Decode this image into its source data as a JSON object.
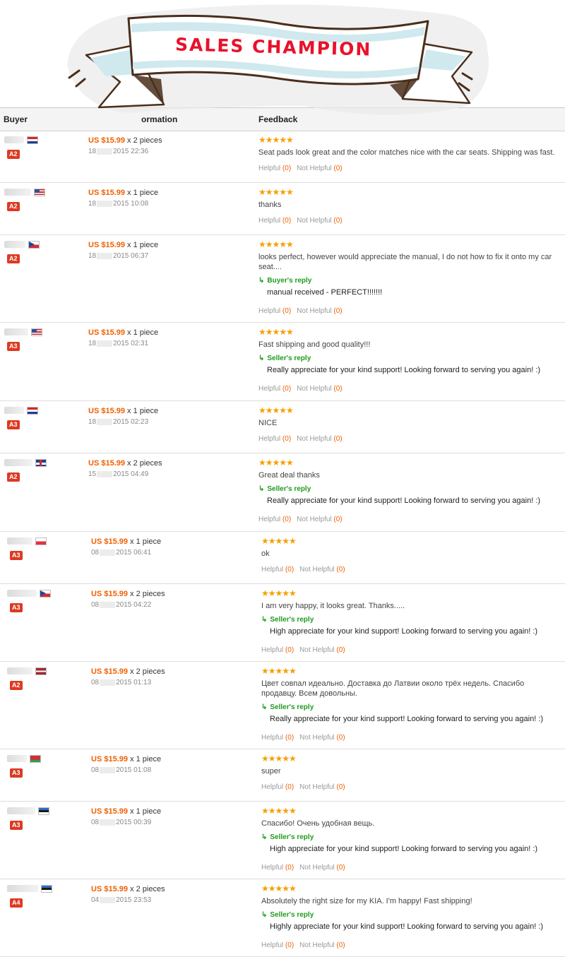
{
  "banner": {
    "title": "SALES CHAMPION"
  },
  "header": {
    "buyer": "Buyer",
    "order": "ormation",
    "feedback": "Feedback"
  },
  "helpful": {
    "helpful_label": "Helpful",
    "not_helpful_label": "Not Helpful"
  },
  "colors": {
    "price": "#f06000",
    "stars": "#f5a000",
    "badge": "#dd3a22",
    "reply": "#1f9a1f",
    "banner_text": "#e8122a"
  },
  "rows": [
    {
      "flag": "croatia-flag",
      "level": "A2",
      "price": "US $15.99",
      "qty": "x 2 pieces",
      "date_a": "18",
      "date_b": "2015 22:36",
      "stars": "★★★★★",
      "text": "Seat pads look great and the color matches nice with the car seats. Shipping was fast.",
      "reply_label": "",
      "reply_text": "",
      "helpful_count": "(0)",
      "not_helpful_count": "(0)"
    },
    {
      "flag": "usa-flag",
      "level": "A2",
      "price": "US $15.99",
      "qty": "x 1 piece",
      "date_a": "18",
      "date_b": "2015 10:08",
      "stars": "★★★★★",
      "text": "thanks",
      "reply_label": "",
      "reply_text": "",
      "helpful_count": "(0)",
      "not_helpful_count": "(0)"
    },
    {
      "flag": "czech-flag",
      "level": "A2",
      "price": "US $15.99",
      "qty": "x 1 piece",
      "date_a": "18",
      "date_b": "2015 06:37",
      "stars": "★★★★★",
      "text": "looks perfect, however would appreciate the manual, I do not how to fix it onto my car seat....",
      "reply_label": "Buyer's reply",
      "reply_text": "manual received - PERFECT!!!!!!!",
      "helpful_count": "(0)",
      "not_helpful_count": "(0)"
    },
    {
      "flag": "usa-flag",
      "level": "A3",
      "price": "US $15.99",
      "qty": "x 1 piece",
      "date_a": "18",
      "date_b": "2015 02:31",
      "stars": "★★★★★",
      "text": "Fast shipping and good quality!!!",
      "reply_label": "Seller's reply",
      "reply_text": "Really appreciate for your kind support! Looking forward to serving you again! :)",
      "helpful_count": "(0)",
      "not_helpful_count": "(0)"
    },
    {
      "flag": "croatia-flag",
      "level": "A3",
      "price": "US $15.99",
      "qty": "x 1 piece",
      "date_a": "18",
      "date_b": "2015 02:23",
      "stars": "★★★★★",
      "text": "NICE",
      "reply_label": "",
      "reply_text": "",
      "helpful_count": "(0)",
      "not_helpful_count": "(0)"
    },
    {
      "flag": "uk-flag",
      "level": "A2",
      "price": "US $15.99",
      "qty": "x 2 pieces",
      "date_a": "15",
      "date_b": "2015 04:49",
      "stars": "★★★★★",
      "text": "Great deal thanks",
      "reply_label": "Seller's reply",
      "reply_text": "Really appreciate for your kind support! Looking forward to serving you again! :)",
      "helpful_count": "(0)",
      "not_helpful_count": "(0)"
    },
    {
      "flag": "poland-flag",
      "level": "A3",
      "price": "US $15.99",
      "qty": "x 1 piece",
      "date_a": "08",
      "date_b": "2015 06:41",
      "stars": "★★★★★",
      "text": "ok",
      "reply_label": "",
      "reply_text": "",
      "helpful_count": "(0)",
      "not_helpful_count": "(0)"
    },
    {
      "flag": "czech-flag",
      "level": "A3",
      "price": "US $15.99",
      "qty": "x 2 pieces",
      "date_a": "08",
      "date_b": "2015 04:22",
      "stars": "★★★★★",
      "text": "I am very happy, it looks great. Thanks.....",
      "reply_label": "Seller's reply",
      "reply_text": "High appreciate for your kind support! Looking forward to serving you again! :)",
      "helpful_count": "(0)",
      "not_helpful_count": "(0)"
    },
    {
      "flag": "latvia-flag",
      "level": "A2",
      "price": "US $15.99",
      "qty": "x 2 pieces",
      "date_a": "08",
      "date_b": "2015 01:13",
      "stars": "★★★★★",
      "text": "Цвет совпал идеально. Доставка до Латвии около трёх недель. Спасибо продавцу. Всем довольны.",
      "reply_label": "Seller's reply",
      "reply_text": "Really appreciate for your kind support! Looking forward to serving you again! :)",
      "helpful_count": "(0)",
      "not_helpful_count": "(0)"
    },
    {
      "flag": "belarus-flag",
      "level": "A3",
      "price": "US $15.99",
      "qty": "x 1 piece",
      "date_a": "08",
      "date_b": "2015 01:08",
      "stars": "★★★★★",
      "text": "super",
      "reply_label": "",
      "reply_text": "",
      "helpful_count": "(0)",
      "not_helpful_count": "(0)"
    },
    {
      "flag": "estonia-flag",
      "level": "A3",
      "price": "US $15.99",
      "qty": "x 1 piece",
      "date_a": "08",
      "date_b": "2015 00:39",
      "stars": "★★★★★",
      "text": "Спасибо! Очень удобная вещь.",
      "reply_label": "Seller's reply",
      "reply_text": "High appreciate for your kind support! Looking forward to serving you again! :)",
      "helpful_count": "(0)",
      "not_helpful_count": "(0)"
    },
    {
      "flag": "estonia-flag",
      "level": "A4",
      "price": "US $15.99",
      "qty": "x 2 pieces",
      "date_a": "04",
      "date_b": "2015 23:53",
      "stars": "★★★★★",
      "text": "Absolutely the right size for my KIA. I'm happy! Fast shipping!",
      "reply_label": "Seller's reply",
      "reply_text": "Highly appreciate for your kind support! Looking forward to serving you again! :)",
      "helpful_count": "(0)",
      "not_helpful_count": "(0)"
    }
  ]
}
